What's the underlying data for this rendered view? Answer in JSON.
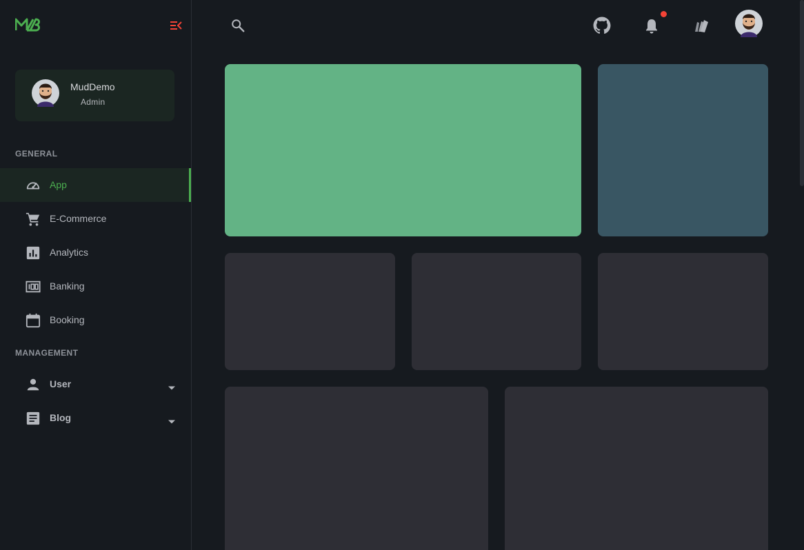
{
  "colors": {
    "background": "#161a1f",
    "accent": "#4caf50",
    "card_green": "#63b385",
    "card_teal": "#395663",
    "card_dark": "#2e2e35",
    "notification": "#f44336"
  },
  "sidebar": {
    "logo_icon": "mudblazor-logo-icon",
    "collapse_icon": "menu-collapse-icon",
    "user": {
      "name": "MudDemo",
      "role": "Admin",
      "avatar_icon": "avatar-icon"
    },
    "sections": [
      {
        "label": "GENERAL",
        "items": [
          {
            "label": "App",
            "icon": "speedometer-icon",
            "active": true
          },
          {
            "label": "E-Commerce",
            "icon": "cart-icon"
          },
          {
            "label": "Analytics",
            "icon": "analytics-icon"
          },
          {
            "label": "Banking",
            "icon": "banking-icon"
          },
          {
            "label": "Booking",
            "icon": "calendar-icon"
          }
        ]
      },
      {
        "label": "MANAGEMENT",
        "items": [
          {
            "label": "User",
            "icon": "person-icon",
            "expandable": true
          },
          {
            "label": "Blog",
            "icon": "article-icon",
            "expandable": true
          }
        ]
      }
    ]
  },
  "header": {
    "search_icon": "search-icon",
    "github_icon": "github-icon",
    "notifications_icon": "bell-icon",
    "theme_icon": "palette-swatch-icon",
    "avatar_icon": "avatar-icon"
  }
}
